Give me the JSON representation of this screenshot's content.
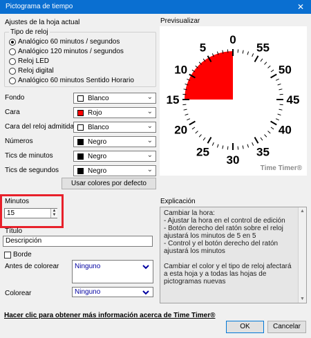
{
  "window": {
    "title": "Pictograma de tiempo",
    "close": "✕"
  },
  "sheet_settings": {
    "label": "Ajustes de la hoja actual"
  },
  "clock_type": {
    "label": "Tipo de reloj",
    "options": [
      {
        "label": "Analógico 60 minutos / segundos",
        "checked": true
      },
      {
        "label": "Analógico 120 minutos / segundos",
        "checked": false
      },
      {
        "label": "Reloj LED",
        "checked": false
      },
      {
        "label": "Reloj digital",
        "checked": false
      },
      {
        "label": "Analógico 60 minutos Sentido Horario",
        "checked": false
      }
    ]
  },
  "colors": {
    "rows": [
      {
        "label": "Fondo",
        "value": "Blanco",
        "swatch": "#ffffff"
      },
      {
        "label": "Cara",
        "value": "Rojo",
        "swatch": "#ff0000"
      },
      {
        "label": "Cara del reloj admitida",
        "value": "Blanco",
        "swatch": "#ffffff"
      },
      {
        "label": "Números",
        "value": "Negro",
        "swatch": "#000000"
      },
      {
        "label": "Tics de minutos",
        "value": "Negro",
        "swatch": "#000000"
      },
      {
        "label": "Tics de segundos",
        "value": "Negro",
        "swatch": "#000000"
      }
    ],
    "default_button": "Usar colores por defecto"
  },
  "minutes": {
    "label": "Minutos",
    "value": "15"
  },
  "title_field": {
    "label": "Título",
    "value": "Descripción"
  },
  "border": {
    "label": "Borde",
    "checked": false
  },
  "before_color": {
    "label": "Antes de colorear",
    "value": "Ninguno"
  },
  "color_select": {
    "label": "Colorear",
    "value": "Ninguno"
  },
  "preview": {
    "label": "Previsualizar",
    "numbers": [
      "0",
      "5",
      "10",
      "15",
      "20",
      "25",
      "30",
      "35",
      "40",
      "45",
      "50",
      "55"
    ],
    "minutes_value": 15,
    "watermark": "Time Timer®",
    "face_color": "#ff0000"
  },
  "explanation": {
    "label": "Explicación",
    "text": "Cambiar la hora:\n- Ajustar la hora en el control de edición\n- Botón derecho del ratón sobre el reloj ajustará los minutos de 5 en 5\n- Control y el botón derecho del ratón ajustará los minutos\n\nCambiar el color y el tipo de reloj afectará a esta hoja y a todas las hojas de pictogramas nuevas"
  },
  "info_link": "Hacer clic para obtener más información acerca de Time Timer®",
  "buttons": {
    "ok": "OK",
    "cancel": "Cancelar"
  },
  "highlight_color": "#e8202a",
  "titlebar_color": "#0a6fd1"
}
